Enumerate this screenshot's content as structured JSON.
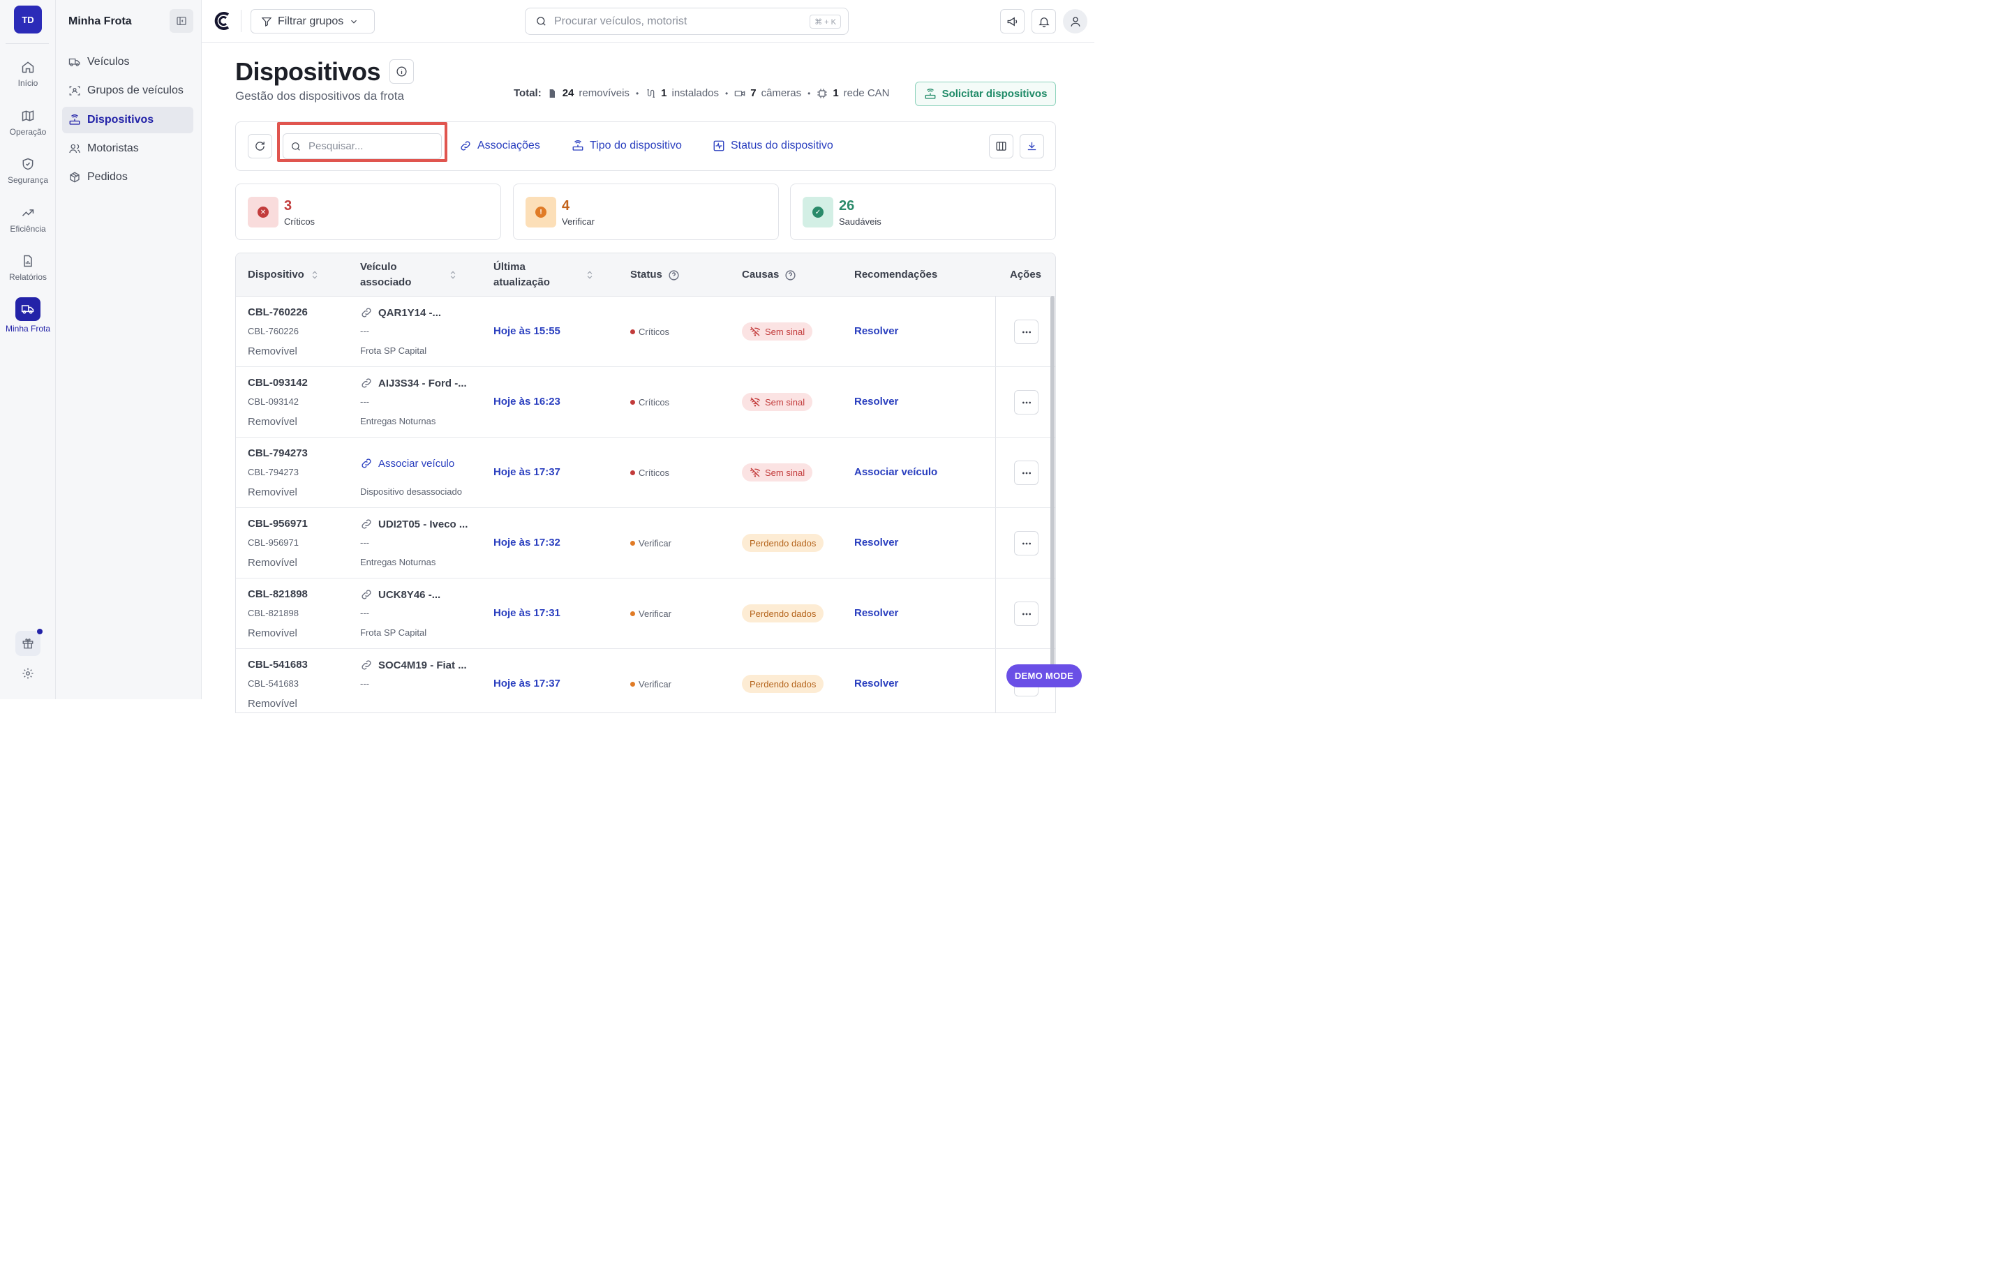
{
  "rail": {
    "avatar": "TD",
    "items": [
      {
        "label": "Início",
        "icon": "home-icon"
      },
      {
        "label": "Operação",
        "icon": "map-icon"
      },
      {
        "label": "Segurança",
        "icon": "shield-icon"
      },
      {
        "label": "Eficiência",
        "icon": "trending-up-icon"
      },
      {
        "label": "Relatórios",
        "icon": "report-icon"
      },
      {
        "label": "Minha Frota",
        "icon": "truck-icon"
      }
    ]
  },
  "sidebar": {
    "title": "Minha Frota",
    "items": [
      {
        "label": "Veículos",
        "icon": "truck-icon"
      },
      {
        "label": "Grupos de veículos",
        "icon": "group-scan-icon"
      },
      {
        "label": "Dispositivos",
        "icon": "router-icon"
      },
      {
        "label": "Motoristas",
        "icon": "users-icon"
      },
      {
        "label": "Pedidos",
        "icon": "package-icon"
      }
    ]
  },
  "topbar": {
    "filter_label": "Filtrar grupos",
    "search_placeholder": "Procurar veículos, motorist",
    "shortcut": "⌘ + K"
  },
  "page": {
    "title": "Dispositivos",
    "subtitle": "Gestão dos dispositivos da frota",
    "totals": {
      "label": "Total:",
      "removiveis_count": "24",
      "removiveis_label": "removíveis",
      "instalados_count": "1",
      "instalados_label": "instalados",
      "cameras_count": "7",
      "cameras_label": "câmeras",
      "can_count": "1",
      "can_label": "rede CAN"
    },
    "request_button": "Solicitar dispositivos"
  },
  "toolbar": {
    "search_placeholder": "Pesquisar...",
    "associations": "Associações",
    "device_type": "Tipo do dispositivo",
    "device_status": "Status do dispositivo"
  },
  "stats": [
    {
      "value": "3",
      "label": "Críticos",
      "color": "#c23b3b"
    },
    {
      "value": "4",
      "label": "Verificar",
      "color": "#c2621a"
    },
    {
      "value": "26",
      "label": "Saudáveis",
      "color": "#2a8a6a"
    }
  ],
  "table": {
    "headers": {
      "device": "Dispositivo",
      "vehicle_l1": "Veículo",
      "vehicle_l2": "associado",
      "update_l1": "Última",
      "update_l2": "atualização",
      "status": "Status",
      "causes": "Causas",
      "recs": "Recomendações",
      "actions": "Ações"
    },
    "rows": [
      {
        "device": "CBL-760226",
        "device_sub": "CBL-760226",
        "type": "Removível",
        "vehicle": "QAR1Y14 -...",
        "vehicle_sub": "---",
        "group": "Frota SP Capital",
        "updated": "Hoje às 15:55",
        "status": "Críticos",
        "cause": "Sem sinal",
        "rec": "Resolver"
      },
      {
        "device": "CBL-093142",
        "device_sub": "CBL-093142",
        "type": "Removível",
        "vehicle": "AIJ3S34 - Ford -...",
        "vehicle_sub": "---",
        "group": "Entregas Noturnas",
        "updated": "Hoje às 16:23",
        "status": "Críticos",
        "cause": "Sem sinal",
        "rec": "Resolver"
      },
      {
        "device": "CBL-794273",
        "device_sub": "CBL-794273",
        "type": "Removível",
        "vehicle": "Associar veículo",
        "vehicle_sub": "",
        "group": "Dispositivo desassociado",
        "updated": "Hoje às 17:37",
        "status": "Críticos",
        "cause": "Sem sinal",
        "rec": "Associar veículo"
      },
      {
        "device": "CBL-956971",
        "device_sub": "CBL-956971",
        "type": "Removível",
        "vehicle": "UDI2T05 - Iveco ...",
        "vehicle_sub": "---",
        "group": "Entregas Noturnas",
        "updated": "Hoje às 17:32",
        "status": "Verificar",
        "cause": "Perdendo dados",
        "rec": "Resolver"
      },
      {
        "device": "CBL-821898",
        "device_sub": "CBL-821898",
        "type": "Removível",
        "vehicle": "UCK8Y46 -...",
        "vehicle_sub": "---",
        "group": "Frota SP Capital",
        "updated": "Hoje às 17:31",
        "status": "Verificar",
        "cause": "Perdendo dados",
        "rec": "Resolver"
      },
      {
        "device": "CBL-541683",
        "device_sub": "CBL-541683",
        "type": "Removível",
        "vehicle": "SOC4M19 - Fiat ...",
        "vehicle_sub": "---",
        "group": "",
        "updated": "Hoje às 17:37",
        "status": "Verificar",
        "cause": "Perdendo dados",
        "rec": "Resolver"
      }
    ]
  },
  "demo_mode": "DEMO MODE",
  "colors": {
    "brand": "#2323a8",
    "link": "#2a3fbf",
    "critical": "#c23b3b",
    "warning": "#e07b26",
    "healthy": "#2a8a6a",
    "highlight": "#e0554f"
  }
}
